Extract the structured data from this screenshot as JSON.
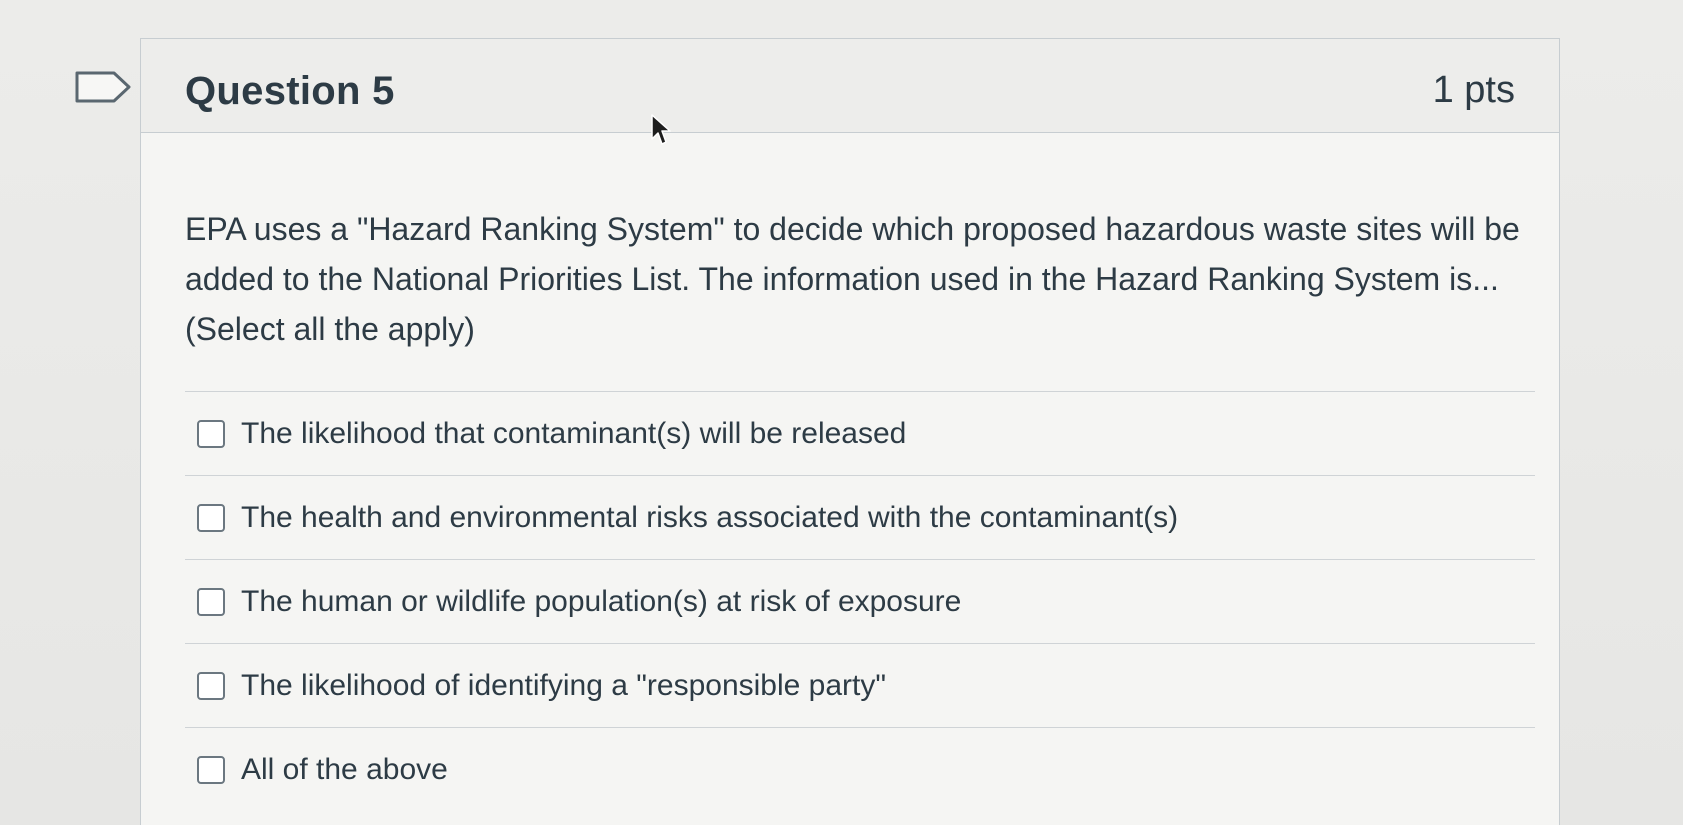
{
  "question": {
    "title": "Question 5",
    "points": "1 pts",
    "text": "EPA uses a \"Hazard Ranking System\" to decide which proposed hazardous waste sites will be added to the National Priorities List.  The information used in the Hazard Ranking System is...  (Select all the apply)"
  },
  "answers": [
    {
      "label": "The likelihood that contaminant(s) will be released",
      "checked": false
    },
    {
      "label": "The health and environmental risks associated with the contaminant(s)",
      "checked": false
    },
    {
      "label": "The human or wildlife population(s) at risk of exposure",
      "checked": false
    },
    {
      "label": "The likelihood of identifying a \"responsible party\"",
      "checked": false
    },
    {
      "label": "All of the above",
      "checked": false
    }
  ],
  "icons": {
    "flag": "flag-question-icon",
    "cursor": "mouse-pointer-icon"
  }
}
